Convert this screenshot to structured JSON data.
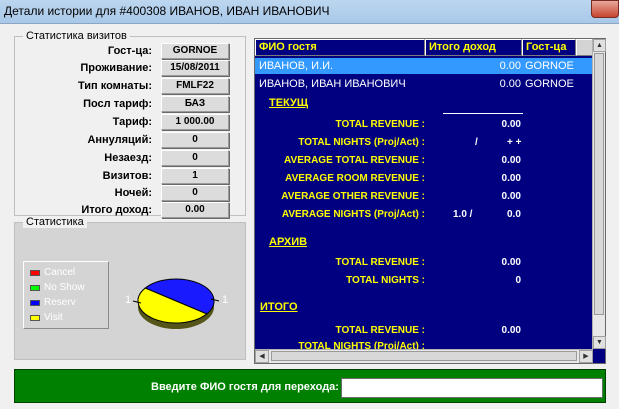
{
  "window": {
    "title": "Детали истории для #400308 ИВАНОВ, ИВАН ИВАНОВИЧ"
  },
  "stats": {
    "title": "Статистика визитов",
    "rows": [
      {
        "label": "Гост-ца:",
        "value": "GORNOE"
      },
      {
        "label": "Проживание:",
        "value": "15/08/2011"
      },
      {
        "label": "Тип комнаты:",
        "value": "FMLF22"
      },
      {
        "label": "Посл тариф:",
        "value": "БАЗ"
      },
      {
        "label": "Тариф:",
        "value": "1 000.00"
      },
      {
        "label": "Аннуляций:",
        "value": "0"
      },
      {
        "label": "Незаезд:",
        "value": "0"
      },
      {
        "label": "Визитов:",
        "value": "1"
      },
      {
        "label": "Ночей:",
        "value": "0"
      },
      {
        "label": "Итого доход:",
        "value": "0.00"
      }
    ]
  },
  "chart_box": {
    "title": "Статистика",
    "legend": [
      {
        "label": "Cancel",
        "color": "#ff0000"
      },
      {
        "label": "No Show",
        "color": "#00ff00"
      },
      {
        "label": "Reserv",
        "color": "#0000ff"
      },
      {
        "label": "Visit",
        "color": "#ffff00"
      }
    ],
    "pie_labels": [
      "1",
      "1"
    ]
  },
  "chart_data": {
    "type": "pie",
    "slices": [
      {
        "name": "Reserv",
        "value": 1,
        "color": "#1a1aff"
      },
      {
        "name": "Visit",
        "value": 1,
        "color": "#ffff00"
      }
    ]
  },
  "grid": {
    "headers": [
      "ФИО гостя",
      "Итого доход",
      "Гост-ца"
    ],
    "rows": [
      {
        "name": "ИВАНОВ, И.И.",
        "income": "0.00",
        "hotel": "GORNOE"
      },
      {
        "name": "ИВАНОВ, ИВАН ИВАНОВИЧ",
        "income": "0.00",
        "hotel": "GORNOE"
      }
    ]
  },
  "details": {
    "current_title": "ТЕКУЩ",
    "current": [
      {
        "label": "TOTAL REVENUE :",
        "value": "0.00"
      },
      {
        "label": "TOTAL NIGHTS (Proj/Act) :",
        "value": "/",
        "value2": "+ +"
      },
      {
        "label": "AVERAGE TOTAL REVENUE :",
        "value": "0.00"
      },
      {
        "label": "AVERAGE ROOM REVENUE :",
        "value": "0.00"
      },
      {
        "label": "AVERAGE OTHER REVENUE :",
        "value": "0.00"
      },
      {
        "label": "AVERAGE NIGHTS (Proj/Act) :",
        "value": "1.0  /",
        "value2": "0.0"
      }
    ],
    "archive_title": "АРХИВ",
    "archive": [
      {
        "label": "TOTAL REVENUE :",
        "value": "0.00"
      },
      {
        "label": "TOTAL NIGHTS :",
        "value": "0"
      }
    ],
    "total_title": "ИТОГО",
    "total": [
      {
        "label": "TOTAL REVENUE :",
        "value": "0.00"
      },
      {
        "label": "TOTAL NIGHTS (Proj/Act) :",
        "value": ""
      }
    ]
  },
  "footer": {
    "label": "Введите ФИО гостя для перехода:",
    "input_value": ""
  }
}
